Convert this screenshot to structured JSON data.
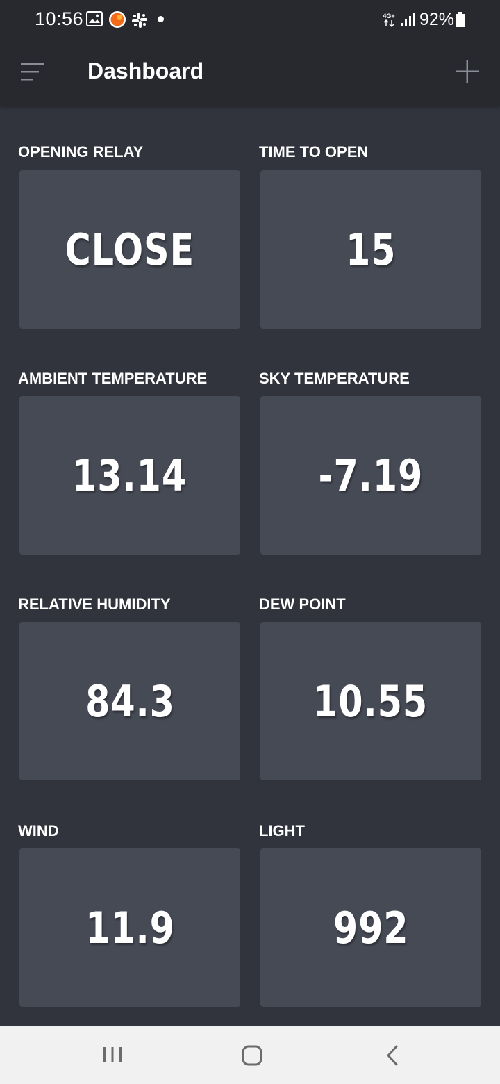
{
  "status_bar": {
    "time": "10:56",
    "network": "4G+",
    "battery": "92%"
  },
  "header": {
    "title": "Dashboard",
    "menu_icon": "menu-icon",
    "add_icon": "plus-icon"
  },
  "tiles": [
    {
      "label": "OPENING RELAY",
      "value": "CLOSE"
    },
    {
      "label": "TIME TO OPEN",
      "value": "15"
    },
    {
      "label": "AMBIENT TEMPERATURE",
      "value": "13.14"
    },
    {
      "label": "SKY TEMPERATURE",
      "value": "-7.19"
    },
    {
      "label": "RELATIVE HUMIDITY",
      "value": "84.3"
    },
    {
      "label": "DEW POINT",
      "value": "10.55"
    },
    {
      "label": "WIND",
      "value": "11.9"
    },
    {
      "label": "LIGHT",
      "value": "992"
    }
  ],
  "colors": {
    "background": "#31343c",
    "header": "#27292f",
    "tile": "#464a55",
    "text": "#ffffff",
    "nav_bar": "#f1f1f1"
  }
}
